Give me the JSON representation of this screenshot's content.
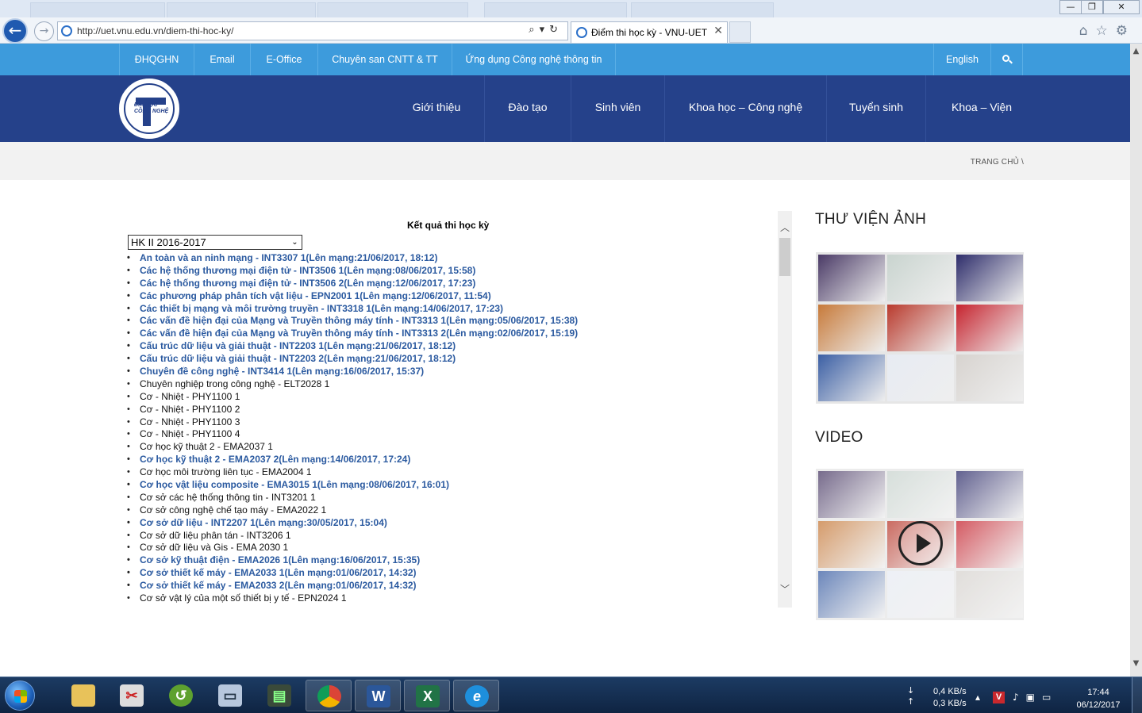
{
  "browser": {
    "url": "http://uet.vnu.edu.vn/diem-thi-hoc-ky/",
    "active_tab_title": "Điểm thi học kỳ - VNU-UET",
    "window_controls": {
      "minimize": "—",
      "restore": "❐",
      "close": "✕"
    }
  },
  "topbar": {
    "links": [
      "ĐHQGHN",
      "Email",
      "E-Office",
      "Chuyên san CNTT & TT",
      "Ứng dụng Công nghệ thông tin"
    ],
    "language": "English"
  },
  "logo": {
    "text_line1": "ĐẠI HỌC",
    "text_line2": "CÔNG NGHỆ"
  },
  "mainnav": {
    "items": [
      "Giới thiệu",
      "Đào tạo",
      "Sinh viên",
      "Khoa học – Công nghệ",
      "Tuyển sinh",
      "Khoa – Viện"
    ]
  },
  "breadcrumb": "TRANG CHỦ \\",
  "results": {
    "title": "Kết quả thi học kỳ",
    "semester_selected": "HK II 2016-2017",
    "courses": [
      {
        "text": "An toàn và an ninh mạng - INT3307 1(Lên mạng:21/06/2017, 18:12)",
        "posted": true
      },
      {
        "text": "Các hệ thống thương mại điện tử - INT3506 1(Lên mạng:08/06/2017, 15:58)",
        "posted": true
      },
      {
        "text": "Các hệ thống thương mại điện tử - INT3506 2(Lên mạng:12/06/2017, 17:23)",
        "posted": true
      },
      {
        "text": "Các phương pháp phân tích vật liệu - EPN2001 1(Lên mạng:12/06/2017, 11:54)",
        "posted": true
      },
      {
        "text": "Các thiết bị mạng và môi trường truyền - INT3318 1(Lên mạng:14/06/2017, 17:23)",
        "posted": true
      },
      {
        "text": "Các vấn đề hiện đại của Mạng và Truyền thông máy tính - INT3313 1(Lên mạng:05/06/2017, 15:38)",
        "posted": true
      },
      {
        "text": "Các vấn đề hiện đại của Mạng và Truyền thông máy tính - INT3313 2(Lên mạng:02/06/2017, 15:19)",
        "posted": true
      },
      {
        "text": "Cấu trúc dữ liệu và giải thuật - INT2203 1(Lên mạng:21/06/2017, 18:12)",
        "posted": true
      },
      {
        "text": "Cấu trúc dữ liệu và giải thuật - INT2203 2(Lên mạng:21/06/2017, 18:12)",
        "posted": true
      },
      {
        "text": "Chuyên đề công nghệ - INT3414 1(Lên mạng:16/06/2017, 15:37)",
        "posted": true
      },
      {
        "text": "Chuyên nghiệp trong công nghệ - ELT2028 1",
        "posted": false
      },
      {
        "text": "Cơ - Nhiệt - PHY1100 1",
        "posted": false
      },
      {
        "text": "Cơ - Nhiệt - PHY1100 2",
        "posted": false
      },
      {
        "text": "Cơ - Nhiệt - PHY1100 3",
        "posted": false
      },
      {
        "text": "Cơ - Nhiệt - PHY1100 4",
        "posted": false
      },
      {
        "text": "Cơ học kỹ thuật 2 - EMA2037 1",
        "posted": false
      },
      {
        "text": "Cơ học kỹ thuật 2 - EMA2037 2(Lên mạng:14/06/2017, 17:24)",
        "posted": true
      },
      {
        "text": "Cơ học môi trường liên tục - EMA2004 1",
        "posted": false
      },
      {
        "text": "Cơ học vật liệu composite - EMA3015 1(Lên mạng:08/06/2017, 16:01)",
        "posted": true
      },
      {
        "text": "Cơ sở các hệ thống thông tin - INT3201 1",
        "posted": false
      },
      {
        "text": "Cơ sở công nghệ chế tạo máy - EMA2022 1",
        "posted": false
      },
      {
        "text": "Cơ sở dữ liệu - INT2207 1(Lên mạng:30/05/2017, 15:04)",
        "posted": true
      },
      {
        "text": "Cơ sở dữ liệu phân tán - INT3206 1",
        "posted": false
      },
      {
        "text": "Cơ sở dữ liệu và Gis - EMA 2030 1",
        "posted": false
      },
      {
        "text": "Cơ sở kỹ thuật điện - EMA2026 1(Lên mạng:16/06/2017, 15:35)",
        "posted": true
      },
      {
        "text": "Cơ sở thiết kế máy - EMA2033 1(Lên mạng:01/06/2017, 14:32)",
        "posted": true
      },
      {
        "text": "Cơ sở thiết kế máy - EMA2033 2(Lên mạng:01/06/2017, 14:32)",
        "posted": true
      },
      {
        "text": "Cơ sở vật lý của một số thiết bị y tế - EPN2024 1",
        "posted": false
      }
    ]
  },
  "sidebar": {
    "gallery_heading": "THƯ VIỆN ẢNH",
    "video_heading": "VIDEO",
    "thumb_colors": [
      "#4a3a66",
      "#c9d4cf",
      "#2e2d6b",
      "#c77a3a",
      "#b93a2d",
      "#c6242f",
      "#3b5fa4",
      "#e7ebf3",
      "#d7d3cf"
    ]
  },
  "taskbar": {
    "apps": [
      "file-explorer",
      "snipping-tool",
      "greenshot",
      "remote-desktop",
      "monitor",
      "chrome",
      "word",
      "excel",
      "internet-explorer"
    ],
    "net_down": "0,4 KB/s",
    "net_up": "0,3 KB/s",
    "time": "17:44",
    "date": "06/12/2017"
  }
}
